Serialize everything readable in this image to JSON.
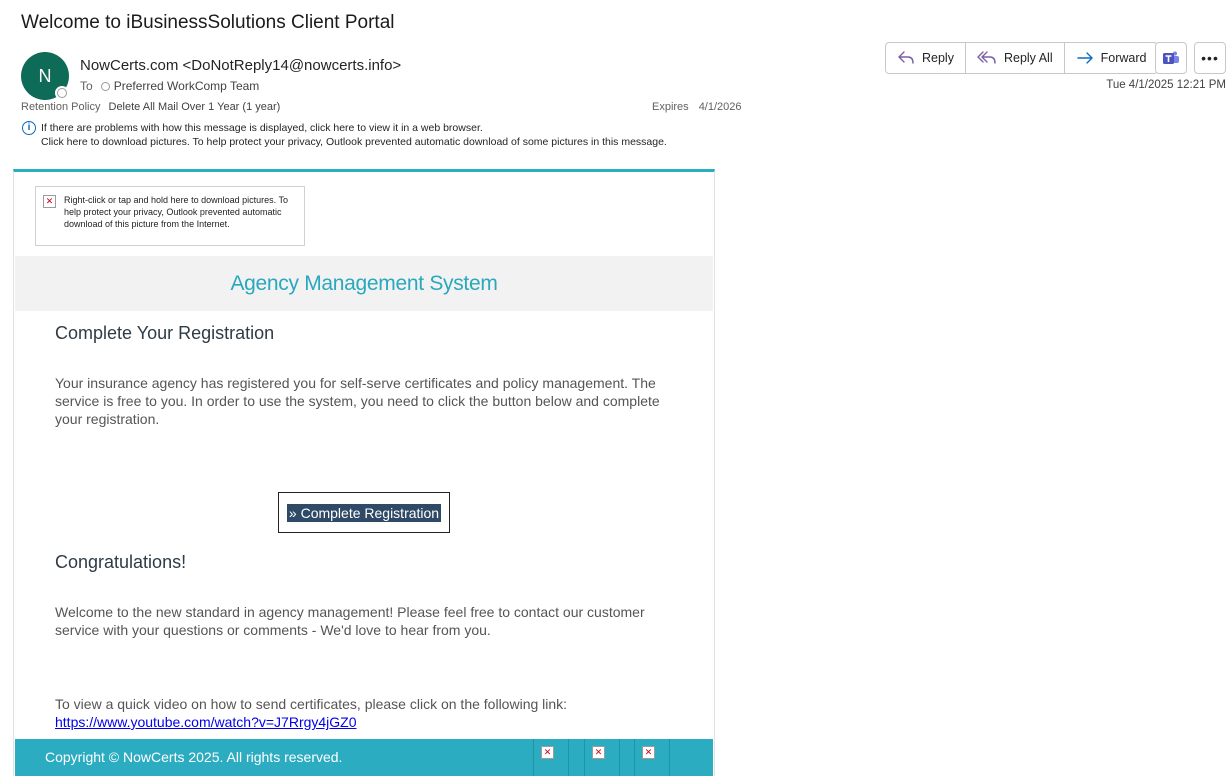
{
  "email": {
    "subject": "Welcome to iBusinessSolutions Client Portal",
    "avatar_initial": "N",
    "sender": "NowCerts.com <DoNotReply14@nowcerts.info>",
    "to_label": "To",
    "recipient": "Preferred WorkComp Team",
    "retention_label": "Retention Policy",
    "retention_value": "Delete All Mail Over 1 Year (1 year)",
    "expires_label": "Expires",
    "expires_value": "4/1/2026",
    "info_line1": "If there are problems with how this message is displayed, click here to view it in a web browser.",
    "info_line2": "Click here to download pictures. To help protect your privacy, Outlook prevented automatic download of some pictures in this message.",
    "datetime": "Tue 4/1/2025 12:21 PM"
  },
  "toolbar": {
    "reply": "Reply",
    "reply_all": "Reply All",
    "forward": "Forward",
    "more": "•••"
  },
  "body": {
    "blocked_image_text": "Right-click or tap and hold here to download pictures. To help protect your privacy, Outlook prevented automatic download of this picture from the Internet.",
    "brand": "Agency Management System",
    "heading1": "Complete Your Registration",
    "para1": "Your insurance agency has registered you for self-serve certificates and policy management. The service is free to you. In order to use the system, you need to click the button below and complete your registration.",
    "cta": "» Complete Registration",
    "heading2": "Congratulations!",
    "para2": "Welcome to the new standard in agency management! Please feel free to contact our customer service with your questions or comments - We'd love to hear from you.",
    "video_text": "To view a quick video on how to send certificates, please click on the following link:",
    "video_link": "https://www.youtube.com/watch?v=J7Rrgy4jGZ0",
    "footer": "Copyright © NowCerts 2025. All rights reserved."
  },
  "colors": {
    "accent": "#2cacc0",
    "avatar": "#0e6b58",
    "cta": "#2f4a66",
    "brand_text": "#2aa8bd"
  }
}
